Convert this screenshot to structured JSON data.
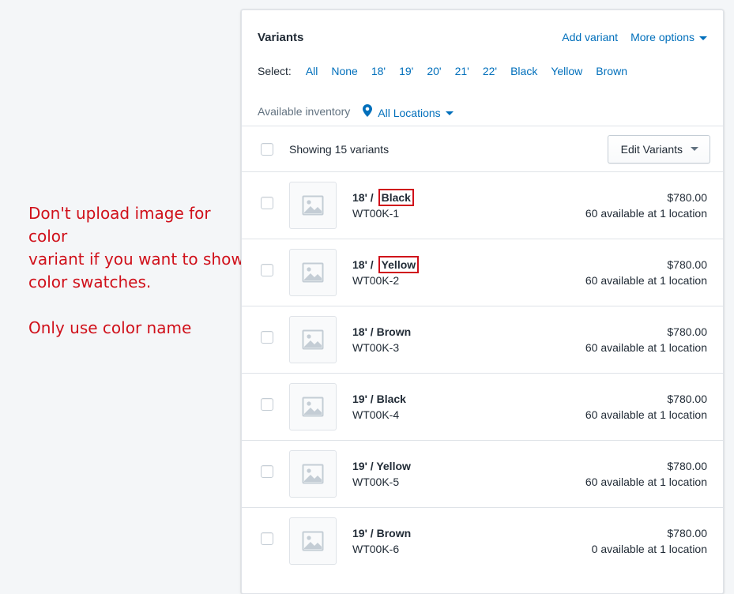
{
  "annotation": {
    "lines": [
      "Don't upload image for color",
      "variant if you want to show",
      "color swatches."
    ],
    "note": "Only use color name",
    "color": "#d0101a"
  },
  "card": {
    "title": "Variants",
    "add_variant": "Add variant",
    "more_options": "More options",
    "select_label": "Select:",
    "select_options": [
      "All",
      "None",
      "18'",
      "19'",
      "20'",
      "21'",
      "22'",
      "Black",
      "Yellow",
      "Brown"
    ],
    "inventory_label": "Available inventory",
    "locations_label": "All Locations",
    "showing_text": "Showing 15 variants",
    "edit_variants": "Edit Variants",
    "accent_color": "#006fbb"
  },
  "variants": [
    {
      "size": "18' /",
      "color": "Black",
      "highlight": true,
      "sku": "WT00K-1",
      "price": "$780.00",
      "availability": "60 available at 1 location"
    },
    {
      "size": "18' /",
      "color": "Yellow",
      "highlight": true,
      "sku": "WT00K-2",
      "price": "$780.00",
      "availability": "60 available at 1 location"
    },
    {
      "size": "18' /",
      "color": "Brown",
      "highlight": false,
      "sku": "WT00K-3",
      "price": "$780.00",
      "availability": "60 available at 1 location"
    },
    {
      "size": "19' /",
      "color": "Black",
      "highlight": false,
      "sku": "WT00K-4",
      "price": "$780.00",
      "availability": "60 available at 1 location"
    },
    {
      "size": "19' /",
      "color": "Yellow",
      "highlight": false,
      "sku": "WT00K-5",
      "price": "$780.00",
      "availability": "60 available at 1 location"
    },
    {
      "size": "19' /",
      "color": "Brown",
      "highlight": false,
      "sku": "WT00K-6",
      "price": "$780.00",
      "availability": "0 available at 1 location"
    }
  ]
}
